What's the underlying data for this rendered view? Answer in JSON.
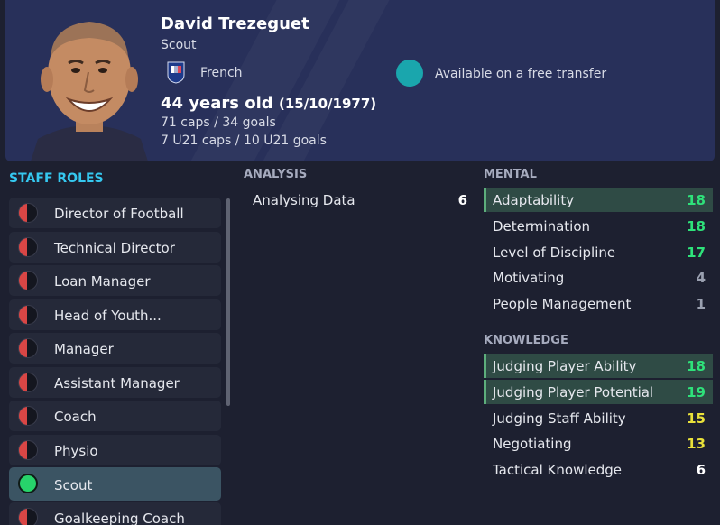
{
  "colors": {
    "background": "#1d2030",
    "header": "#28305a",
    "section_title": "#35c8f0",
    "value_elite": "#2ee27a",
    "value_good": "#e9e13a",
    "value_normal": "#ffffff",
    "value_low": "#9aa0b0",
    "highlight_row": "#2f4b45",
    "role_on": "#27d36b",
    "role_off": "#d94645",
    "status": "#1aa6ad"
  },
  "profile": {
    "name": "David Trezeguet",
    "role": "Scout",
    "nationality": "French",
    "flag_icon": "france-federation-icon",
    "status": "Available on a free transfer",
    "age": "44 years old",
    "dob": "(15/10/1977)",
    "caps": "71 caps / 34 goals",
    "u21": "7 U21 caps / 10 U21 goals"
  },
  "staff_roles": {
    "title": "STAFF ROLES",
    "items": [
      {
        "label": "Director of Football",
        "active": false
      },
      {
        "label": "Technical Director",
        "active": false
      },
      {
        "label": "Loan Manager",
        "active": false
      },
      {
        "label": "Head of Youth...",
        "active": false
      },
      {
        "label": "Manager",
        "active": false
      },
      {
        "label": "Assistant Manager",
        "active": false
      },
      {
        "label": "Coach",
        "active": false
      },
      {
        "label": "Physio",
        "active": false
      },
      {
        "label": "Scout",
        "active": true
      },
      {
        "label": "Goalkeeping Coach",
        "active": false
      }
    ]
  },
  "analysis": {
    "title": "ANALYSIS",
    "items": [
      {
        "name": "Analysing Data",
        "value": "6",
        "tier": "normal",
        "highlight": false
      }
    ]
  },
  "mental": {
    "title": "MENTAL",
    "items": [
      {
        "name": "Adaptability",
        "value": "18",
        "tier": "elite",
        "highlight": true
      },
      {
        "name": "Determination",
        "value": "18",
        "tier": "elite",
        "highlight": false
      },
      {
        "name": "Level of Discipline",
        "value": "17",
        "tier": "elite",
        "highlight": false
      },
      {
        "name": "Motivating",
        "value": "4",
        "tier": "low",
        "highlight": false
      },
      {
        "name": "People Management",
        "value": "1",
        "tier": "low",
        "highlight": false
      }
    ]
  },
  "knowledge": {
    "title": "KNOWLEDGE",
    "items": [
      {
        "name": "Judging Player Ability",
        "value": "18",
        "tier": "elite",
        "highlight": true
      },
      {
        "name": "Judging Player Potential",
        "value": "19",
        "tier": "elite",
        "highlight": true
      },
      {
        "name": "Judging Staff Ability",
        "value": "15",
        "tier": "good",
        "highlight": false
      },
      {
        "name": "Negotiating",
        "value": "13",
        "tier": "good",
        "highlight": false
      },
      {
        "name": "Tactical Knowledge",
        "value": "6",
        "tier": "normal",
        "highlight": false
      }
    ]
  }
}
